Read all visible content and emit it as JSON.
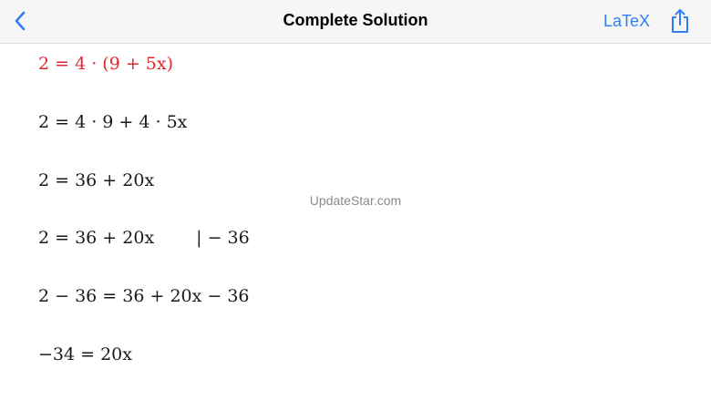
{
  "nav": {
    "title": "Complete Solution",
    "latex_label": "LaTeX",
    "accent_color": "#2f7ef5",
    "back_icon": "chevron-left-icon",
    "share_icon": "share-icon"
  },
  "watermark": "UpdateStar.com",
  "steps": [
    {
      "text": "2 = 4 · (9 + 5x)",
      "highlighted": true
    },
    {
      "text": "2 = 4 · 9 + 4 · 5x",
      "highlighted": false
    },
    {
      "text": "2 = 36 + 20x",
      "highlighted": false
    },
    {
      "text": "2 = 36 + 20x",
      "annotation": "| − 36",
      "highlighted": false
    },
    {
      "text": "2 − 36 = 36 + 20x − 36",
      "highlighted": false
    },
    {
      "text": "−34 = 20x",
      "highlighted": false
    }
  ],
  "highlight_color": "#e0262b"
}
